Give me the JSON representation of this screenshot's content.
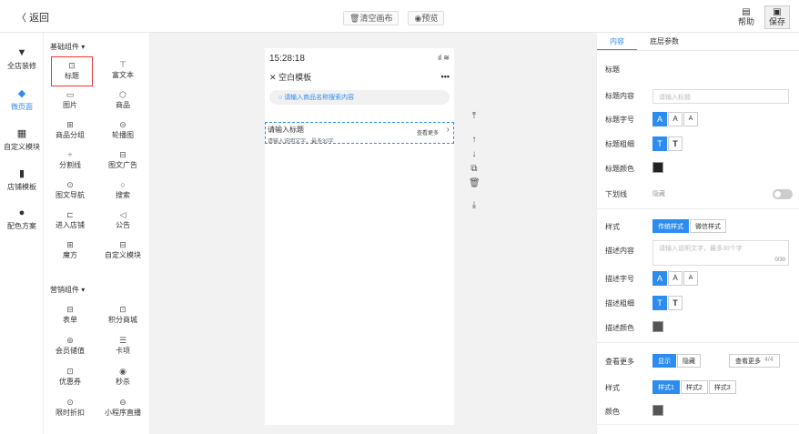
{
  "topbar": {
    "back_label": "返回",
    "clear_label": "清空画布",
    "preview_label": "预览",
    "help_label": "帮助",
    "save_label": "保存"
  },
  "leftnav": [
    {
      "label": "全店装修",
      "icon": "brush-icon"
    },
    {
      "label": "微页面",
      "icon": "cube-icon"
    },
    {
      "label": "自定义模块",
      "icon": "custom-module-icon"
    },
    {
      "label": "店铺模板",
      "icon": "template-icon"
    },
    {
      "label": "配色方案",
      "icon": "palette-icon"
    }
  ],
  "components": {
    "basic_title": "基础组件",
    "basic": [
      "标题",
      "富文本",
      "图片",
      "商品",
      "商品分组",
      "轮播图",
      "分割线",
      "图文广告",
      "图文导航",
      "搜索",
      "进入店铺",
      "公告",
      "魔方",
      "自定义模块"
    ],
    "marketing_title": "营销组件",
    "marketing": [
      "表单",
      "积分商城",
      "会员储值",
      "卡项",
      "优惠券",
      "秒杀",
      "限时折扣",
      "小程序直播"
    ]
  },
  "phone": {
    "time": "15:28:18",
    "page_title": "空白模板",
    "search_placeholder": "请输入商品名称搜索内容",
    "block_title": "请输入标题",
    "block_desc": "请输入说明文字，最多30字",
    "block_more": "查看更多"
  },
  "right": {
    "tab_content": "内容",
    "tab_layer": "底层参数",
    "section_title": "标题",
    "title_content_label": "标题内容",
    "title_content_placeholder": "请输入标题",
    "title_size_label": "标题字号",
    "title_weight_label": "标题粗细",
    "title_color_label": "标题颜色",
    "underline_label": "下划线",
    "underline_value": "隐藏",
    "style_label": "样式",
    "style_opt1": "传统样式",
    "style_opt2": "微信样式",
    "desc_content_label": "描述内容",
    "desc_placeholder": "请输入说明文字，最多30个字",
    "desc_count": "0/30",
    "desc_size_label": "描述字号",
    "desc_weight_label": "描述粗细",
    "desc_color_label": "描述颜色",
    "more_label": "查看更多",
    "more_show": "显示",
    "more_hide": "隐藏",
    "more_preview": "查看更多",
    "more_count": "4/4",
    "style2_label": "样式",
    "s1": "样式1",
    "s2": "样式2",
    "s3": "样式3",
    "color_label": "颜色",
    "font_letter": "A",
    "weight_letter": "T"
  }
}
